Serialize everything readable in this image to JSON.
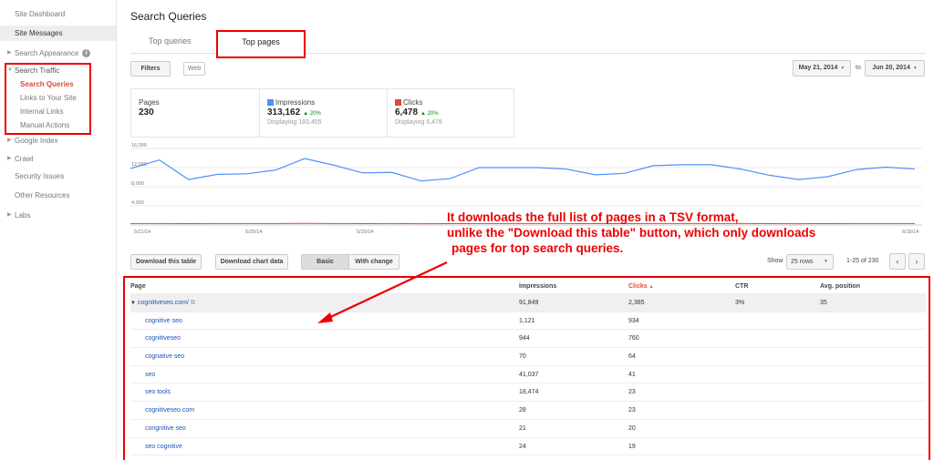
{
  "sidebar": {
    "dashboard": "Site Dashboard",
    "messages": "Site Messages",
    "appearance": "Search Appearance",
    "traffic": "Search Traffic",
    "traffic_items": [
      "Search Queries",
      "Links to Your Site",
      "Internal Links",
      "Manual Actions"
    ],
    "google_index": "Google Index",
    "crawl": "Crawl",
    "security": "Security Issues",
    "other": "Other Resources",
    "labs": "Labs"
  },
  "header": {
    "title": "Search Queries",
    "tabs": [
      "Top queries",
      "Top pages"
    ],
    "active_tab": "Top pages"
  },
  "filters": {
    "filters_label": "Filters",
    "web_label": "Web",
    "date_from": "May 21, 2014",
    "to": "to",
    "date_to": "Jun 20, 2014"
  },
  "metrics": {
    "pages_label": "Pages",
    "pages_value": "230",
    "impressions_label": "Impressions",
    "impressions_value": "313,162",
    "impressions_change": "20%",
    "impressions_sub": "Displaying 183,455",
    "clicks_label": "Clicks",
    "clicks_value": "6,478",
    "clicks_change": "20%",
    "clicks_sub": "Displaying 6,478"
  },
  "colors": {
    "impressions": "#4d90fe",
    "clicks": "#dd4b39",
    "annotation": "#ee0000"
  },
  "chart_data": {
    "type": "line",
    "y_ticks": [
      "16,000",
      "12,000",
      "8,000",
      "4,000"
    ],
    "ylim": [
      0,
      16000
    ],
    "x_ticks": [
      "5/21/14",
      "5/25/14",
      "5/29/14",
      "6/18/14"
    ],
    "series": [
      {
        "name": "Impressions",
        "values": [
          11800,
          13600,
          9500,
          10600,
          10700,
          11500,
          13900,
          12500,
          10900,
          11000,
          9200,
          9700,
          12000,
          12000,
          12000,
          11700,
          10500,
          10800,
          12400,
          12600,
          12600,
          11700,
          10400,
          9500,
          10100,
          11600,
          12100,
          11700
        ]
      },
      {
        "name": "Clicks",
        "values": [
          300,
          320,
          280,
          300,
          310,
          300,
          330,
          320,
          290,
          300,
          270,
          280,
          310,
          310,
          310,
          300,
          290,
          290,
          310,
          320,
          320,
          300,
          280,
          270,
          280,
          300,
          310,
          300
        ]
      }
    ]
  },
  "toolbar": {
    "download_table": "Download this table",
    "download_chart": "Download chart data",
    "basic": "Basic",
    "with_change": "With change",
    "show": "Show",
    "rows": "25 rows",
    "range": "1-25 of 230"
  },
  "table": {
    "headers": [
      "Page",
      "Impressions",
      "Clicks",
      "CTR",
      "Avg. position"
    ],
    "parent": {
      "page": "cognitiveseo.com/",
      "impressions": "91,849",
      "clicks": "2,385",
      "ctr": "3%",
      "position": "35"
    },
    "rows": [
      {
        "page": "cognitive seo",
        "impressions": "1,121",
        "clicks": "934"
      },
      {
        "page": "cognitiveseo",
        "impressions": "944",
        "clicks": "760"
      },
      {
        "page": "cognative seo",
        "impressions": "70",
        "clicks": "64"
      },
      {
        "page": "seo",
        "impressions": "41,037",
        "clicks": "41"
      },
      {
        "page": "seo tools",
        "impressions": "18,474",
        "clicks": "23"
      },
      {
        "page": "cognitiveseo.com",
        "impressions": "28",
        "clicks": "23"
      },
      {
        "page": "congnitive seo",
        "impressions": "21",
        "clicks": "20"
      },
      {
        "page": "seo cognitive",
        "impressions": "24",
        "clicks": "19"
      }
    ]
  },
  "annotation": {
    "line1": "It downloads the full list of pages in a TSV format,",
    "line2": "unlike the \"Download this table\" button, which only downloads",
    "line3": "pages for top search queries."
  }
}
